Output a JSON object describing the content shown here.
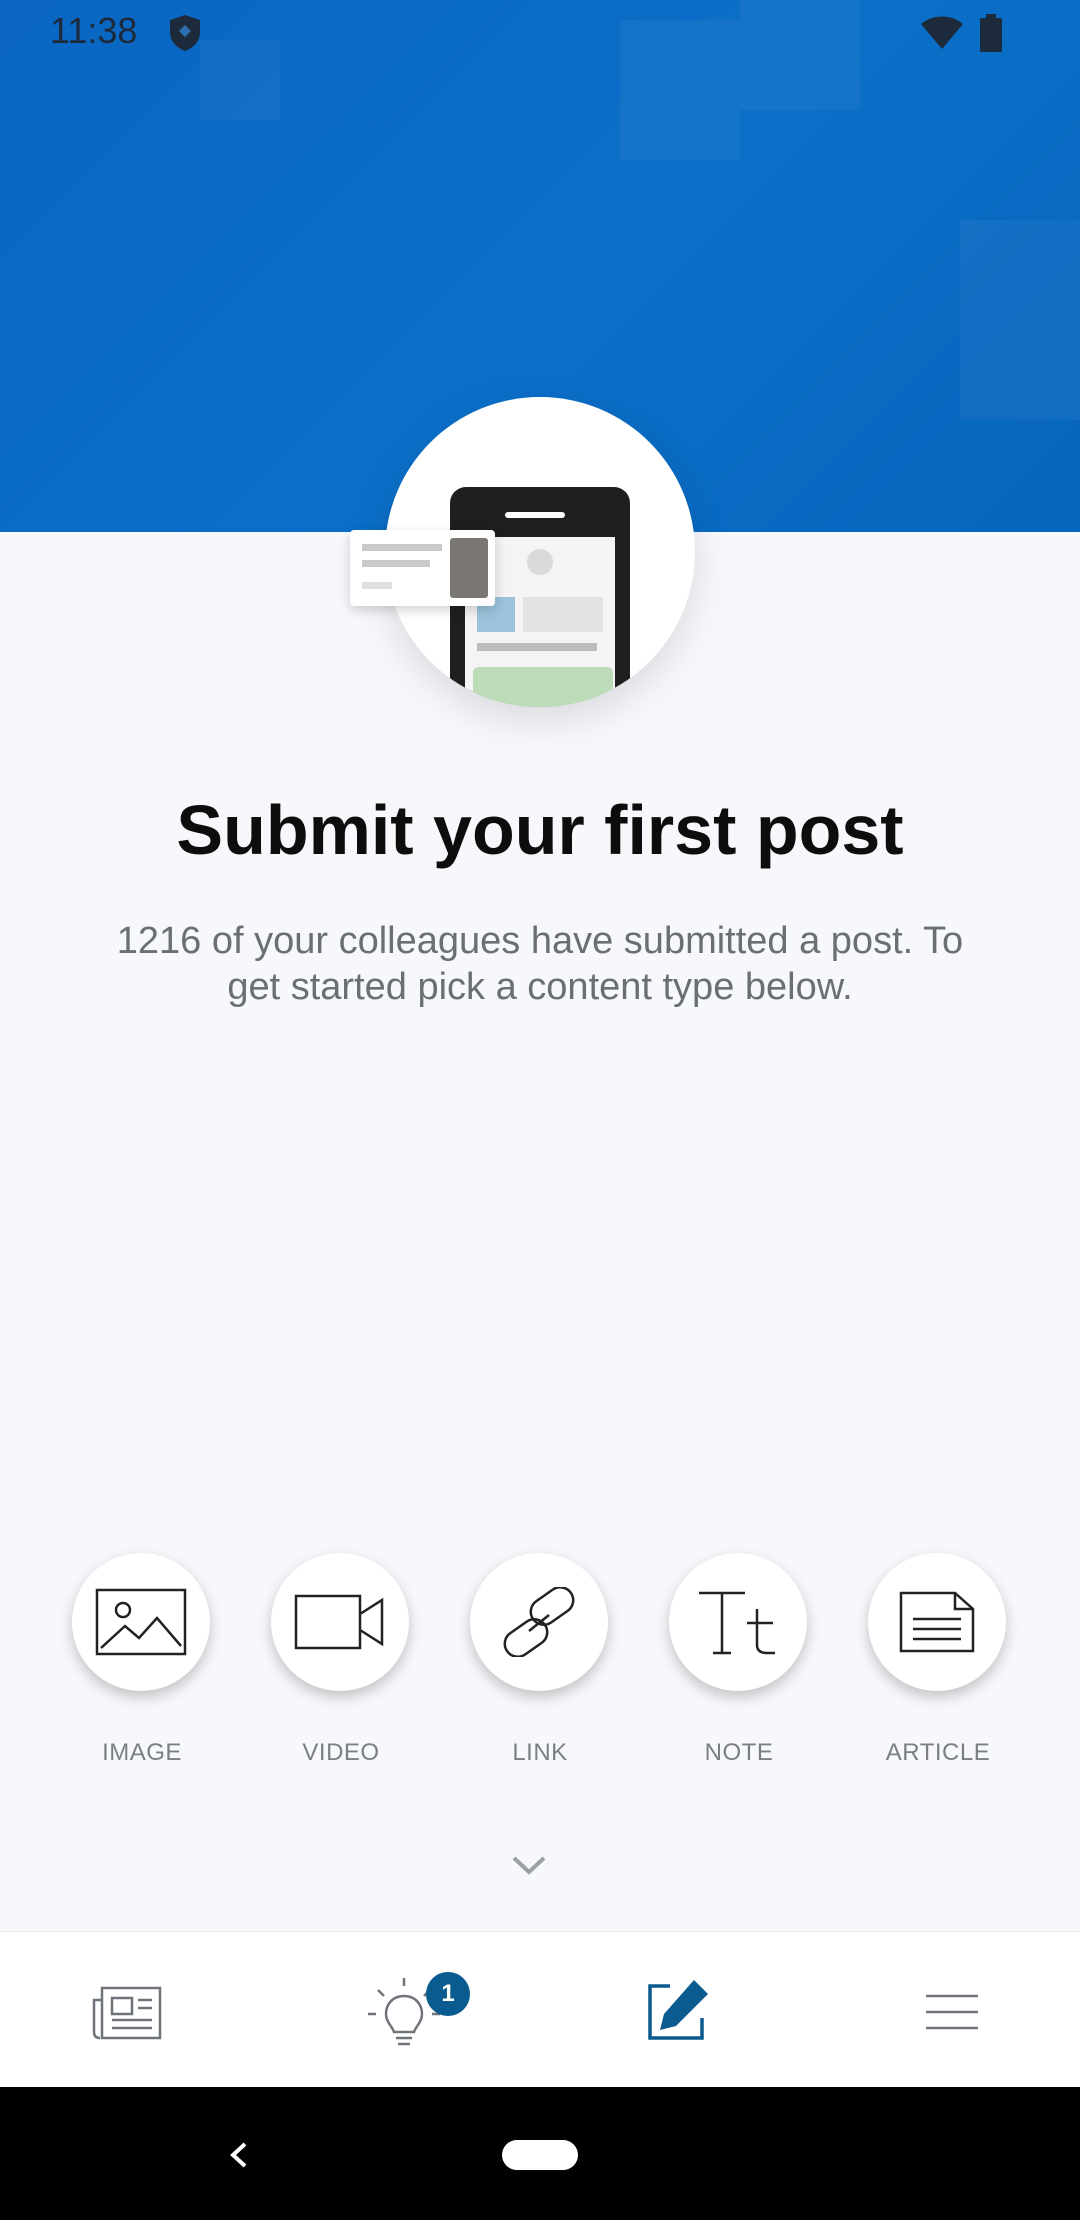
{
  "status_bar": {
    "time": "11:38"
  },
  "headline": "Submit your first post",
  "subtext": "1216 of your colleagues have submitted a post. To get started pick a content type below.",
  "content_types": [
    {
      "label": "IMAGE",
      "icon": "image-icon"
    },
    {
      "label": "VIDEO",
      "icon": "video-icon"
    },
    {
      "label": "LINK",
      "icon": "link-icon"
    },
    {
      "label": "NOTE",
      "icon": "note-icon"
    },
    {
      "label": "ARTICLE",
      "icon": "article-icon"
    }
  ],
  "bottom_nav": {
    "items": [
      "news-feed-icon",
      "lightbulb-icon",
      "compose-icon",
      "menu-icon"
    ],
    "badge_count": "1",
    "active_color": "#0a5b8f"
  },
  "colors": {
    "hero": "#0a66c2",
    "accent": "#0a5b8f"
  }
}
